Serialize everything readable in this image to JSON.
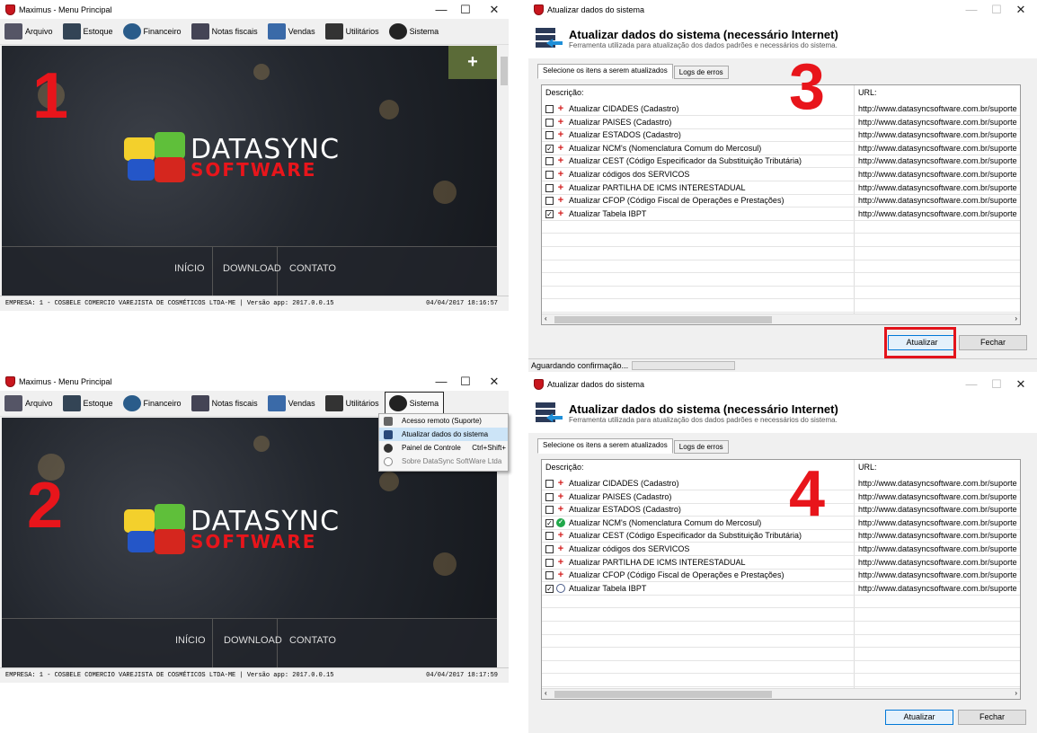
{
  "main_window": {
    "title": "Maximus - Menu Principal",
    "menu": [
      {
        "label": "Arquivo",
        "icon": "archive-icon"
      },
      {
        "label": "Estoque",
        "icon": "truck-icon"
      },
      {
        "label": "Financeiro",
        "icon": "money-icon"
      },
      {
        "label": "Notas fiscais",
        "icon": "printer-icon"
      },
      {
        "label": "Vendas",
        "icon": "chart-icon"
      },
      {
        "label": "Utilitários",
        "icon": "tools-icon"
      },
      {
        "label": "Sistema",
        "icon": "gear-icon"
      }
    ],
    "plus_label": "+",
    "logo_line1": "DATASYNC",
    "logo_line2": "SOFTWARE",
    "nav": [
      "INÍCIO",
      "DOWNLOAD",
      "CONTATO"
    ],
    "status_company": "EMPRESA: 1 - COSBELE COMERCIO VAREJISTA DE COSMÉTICOS LTDA-ME | Versão app: 2017.0.0.15",
    "status_time_1": "04/04/2017 18:16:57",
    "status_time_2": "04/04/2017 18:17:59"
  },
  "step_numbers": [
    "1",
    "2",
    "3",
    "4"
  ],
  "sistema_menu": [
    {
      "label": "Acesso remoto (Suporte)",
      "shortcut": "",
      "icon": "remote-icon"
    },
    {
      "label": "Atualizar dados do sistema",
      "shortcut": "",
      "icon": "update-icon"
    },
    {
      "label": "Painel de Controle",
      "shortcut": "Ctrl+Shift+",
      "icon": "gear-icon"
    },
    {
      "label": "Sobre DataSync SoftWare Ltda",
      "shortcut": "",
      "icon": "info-icon"
    }
  ],
  "update_dialog": {
    "title": "Atualizar dados do sistema",
    "heading": "Atualizar dados do sistema (necessário Internet)",
    "subtitle": "Ferramenta utilizada para atualização dos dados padrões e necessários do sistema.",
    "tabs": [
      "Selecione os itens a serem atualizados",
      "Logs de erros"
    ],
    "col_desc": "Descrição:",
    "col_url": "URL:",
    "url": "http://www.datasyncsoftware.com.br/suporte",
    "items": [
      "Atualizar CIDADES (Cadastro)",
      "Atualizar PAISES (Cadastro)",
      "Atualizar ESTADOS (Cadastro)",
      "Atualizar NCM's (Nomenclatura Comum do Mercosul)",
      "Atualizar CEST (Código Especificador da Substituição Tributária)",
      "Atualizar códigos dos SERVICOS",
      "Atualizar PARTILHA DE ICMS INTERESTADUAL",
      "Atualizar CFOP (Código Fiscal de Operações e Prestações)",
      "Atualizar Tabela IBPT"
    ],
    "checked": [
      false,
      false,
      false,
      true,
      false,
      false,
      false,
      false,
      true
    ],
    "status_icons_after": [
      "plus",
      "plus",
      "plus",
      "ok",
      "plus",
      "plus",
      "plus",
      "plus",
      "clock"
    ],
    "btn_update": "Atualizar",
    "btn_close": "Fechar",
    "status_text": "Aguardando confirmação..."
  },
  "colors": {
    "accent_red": "#e3131b",
    "highlight": "#cce4f7",
    "plus_box": "#5b6b38"
  }
}
